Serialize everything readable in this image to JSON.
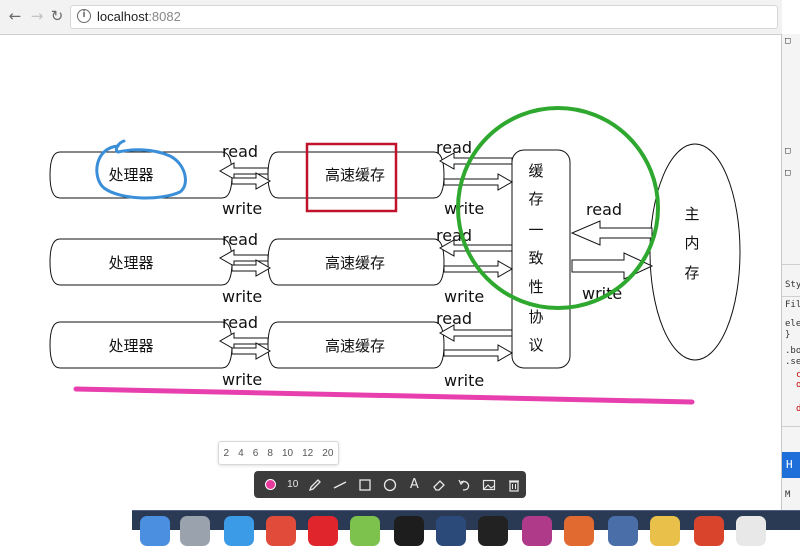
{
  "browser": {
    "url_host": "localhost",
    "url_port": ":8082",
    "back_icon": "arrow-left-icon",
    "forward_icon": "arrow-right-icon",
    "reload_icon": "reload-icon",
    "info_icon": "info-icon"
  },
  "diagram": {
    "processor_label": "处理器",
    "cache_label": "高速缓存",
    "read_label": "read",
    "write_label": "write",
    "coherence_chars": [
      "缓",
      "存",
      "一",
      "致",
      "性",
      "协",
      "议"
    ],
    "memory_chars": [
      "主",
      "内",
      "存"
    ]
  },
  "annotation_colors": {
    "blue_circle": "#3a8fd8",
    "red_box": "#c0122a",
    "green_circle": "#2ea82e",
    "pink_line": "#e83fae"
  },
  "toolbar": {
    "pen_sizes": [
      "2",
      "4",
      "6",
      "8",
      "10",
      "12",
      "20"
    ],
    "current_size": "10",
    "current_color": "#e8399c",
    "tools": [
      "pencil-icon",
      "line-icon",
      "rectangle-icon",
      "circle-icon",
      "text-icon",
      "eraser-icon",
      "undo-icon",
      "image-icon",
      "trash-icon"
    ],
    "text_tool_glyph": "A"
  },
  "devtools": {
    "tab_label": "Sty",
    "filter_label": "Filte",
    "lines": [
      "ele",
      "}",
      ".bo",
      ".se"
    ],
    "panel_tab": "H"
  }
}
